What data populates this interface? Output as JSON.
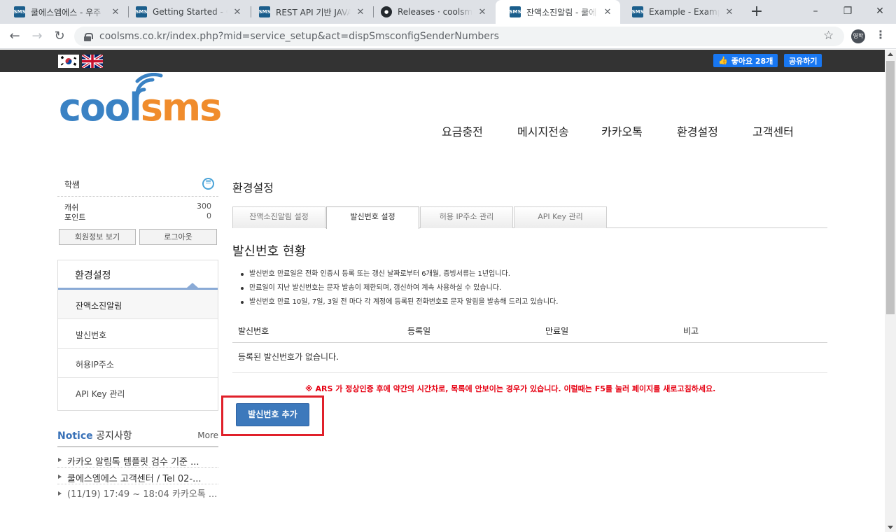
{
  "browser": {
    "tabs": [
      {
        "title": "쿨에스엠에스 - 우주",
        "icon": "sms-favicon"
      },
      {
        "title": "Getting Started - Ge",
        "icon": "sms-favicon"
      },
      {
        "title": "REST API 기반 JAVA",
        "icon": "sms-favicon"
      },
      {
        "title": "Releases · coolsms/j",
        "icon": "github-favicon"
      },
      {
        "title": "잔액소진알림 - 쿨에",
        "icon": "sms-favicon",
        "active": true
      },
      {
        "title": "Example - Example",
        "icon": "sms-favicon"
      }
    ],
    "new_tab": "+",
    "url": "coolsms.co.kr/index.php?mid=service_setup&act=dispSmsconfigSenderNumbers",
    "profile": "영학",
    "favicon_text": "SMS"
  },
  "topbar": {
    "like_label": "좋아요 28개",
    "share_label": "공유하기"
  },
  "logo": {
    "part1": "cool",
    "part2": "sms",
    "color1": "#3a82c4",
    "color2": "#f08c2c"
  },
  "gnb": [
    "요금충전",
    "메시지전송",
    "카카오톡",
    "환경설정",
    "고객센터"
  ],
  "user": {
    "name": "학쌤",
    "cash_label": "캐쉬",
    "cash_value": "300",
    "point_label": "포인트",
    "point_value": "0",
    "profile_button": "회원정보 보기",
    "logout_button": "로그아웃"
  },
  "lnb": {
    "title": "환경설정",
    "items": [
      "잔액소진알림",
      "발신번호",
      "허용IP주소",
      "API Key 관리"
    ]
  },
  "notice": {
    "title_en": "Notice",
    "title_ko": "공지사항",
    "more": "More",
    "items": [
      "카카오 알림톡 템플릿 검수 기준 ...",
      "쿨에스엠에스 고객센터 / Tel 02-...",
      "(11/19) 17:49 ~ 18:04 카카오톡 ..."
    ]
  },
  "main": {
    "page_title": "환경설정",
    "tabs": [
      "잔액소진알림 설정",
      "발신번호 설정",
      "허용 IP주소 관리",
      "API Key 관리"
    ],
    "section_title": "발신번호 현황",
    "bullets": [
      "발신번호 만료일은 전화 인증시 등록 또는 갱신 날짜로부터 6개월, 증빙서류는 1년입니다.",
      "만료일이 지난 발신번호는 문자 발송이 제한되며, 갱신하여 계속 사용하실 수 있습니다.",
      "발신번호 만료 10일, 7일, 3일 전 마다 각 계정에 등록된 전화번호로 문자 알림을 발송해 드리고 있습니다."
    ],
    "table_headers": [
      "발신번호",
      "등록일",
      "만료일",
      "비고"
    ],
    "empty_text": "등록된 발신번호가 없습니다.",
    "warning": "※ ARS 가 정상인증 후에 약간의 시간차로, 목록에 안보이는 경우가 있습니다. 이럴때는 F5를 눌러 페이지를 새로고침하세요.",
    "add_button": "발신번호 추가"
  }
}
